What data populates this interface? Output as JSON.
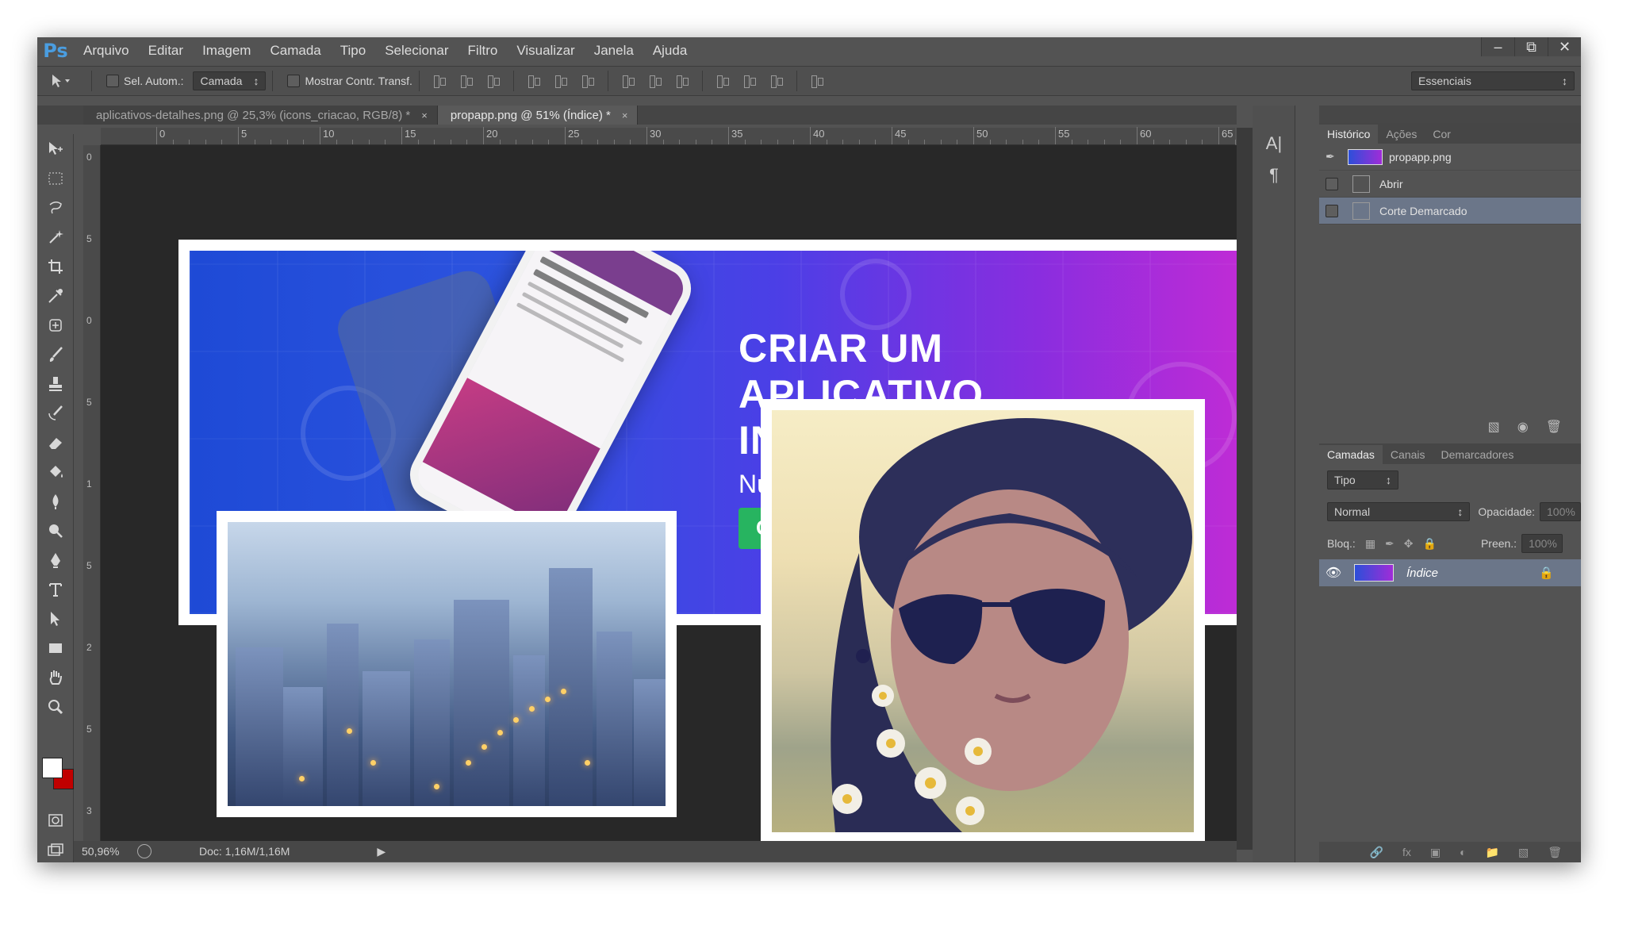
{
  "app": {
    "logo": "Ps",
    "menu": [
      "Arquivo",
      "Editar",
      "Imagem",
      "Camada",
      "Tipo",
      "Selecionar",
      "Filtro",
      "Visualizar",
      "Janela",
      "Ajuda"
    ],
    "window_controls": {
      "minimize": "–",
      "restore": "⧉",
      "close": "✕"
    }
  },
  "options": {
    "auto_select_label": "Sel. Autom.:",
    "auto_select_value": "Camada",
    "transform_label": "Mostrar Contr. Transf.",
    "workspace": "Essenciais"
  },
  "tabs": [
    {
      "label": "aplicativos-detalhes.png @ 25,3% (icons_criacao, RGB/8) *",
      "close": "×"
    },
    {
      "label": "propapp.png @ 51% (Índice) *",
      "close": "×"
    }
  ],
  "ruler": {
    "h_labels": [
      "0",
      "5",
      "10",
      "15",
      "20",
      "25",
      "30",
      "35",
      "40",
      "45",
      "50",
      "55",
      "60",
      "65"
    ],
    "v_labels": [
      "0",
      "5",
      "0",
      "5",
      "1",
      "5",
      "2",
      "5",
      "3"
    ]
  },
  "artwork": {
    "banner_title": "CRIAR UM\nAPLICATIVO\nINOVADOR",
    "banner_subtitle": "Nu",
    "cta_text": "C"
  },
  "status": {
    "zoom": "50,96%",
    "doc": "Doc: 1,16M/1,16M"
  },
  "history_panel": {
    "tabs": [
      "Histórico",
      "Ações",
      "Cor"
    ],
    "snapshot": "propapp.png",
    "items": [
      "Abrir",
      "Corte Demarcado"
    ]
  },
  "layers_panel": {
    "tabs": [
      "Camadas",
      "Canais",
      "Demarcadores"
    ],
    "filter": "Tipo",
    "blend_mode": "Normal",
    "opacity_label": "Opacidade:",
    "opacity_value": "100%",
    "lock_label": "Bloq.:",
    "fill_label": "Preen.:",
    "fill_value": "100%",
    "layer_name": "Índice"
  },
  "colors": {
    "chrome": "#535353",
    "canvas": "#282828",
    "selection": "#6b7689",
    "ps_blue": "#4a9de0",
    "foreground": "#ffffff",
    "background": "#c00000"
  }
}
